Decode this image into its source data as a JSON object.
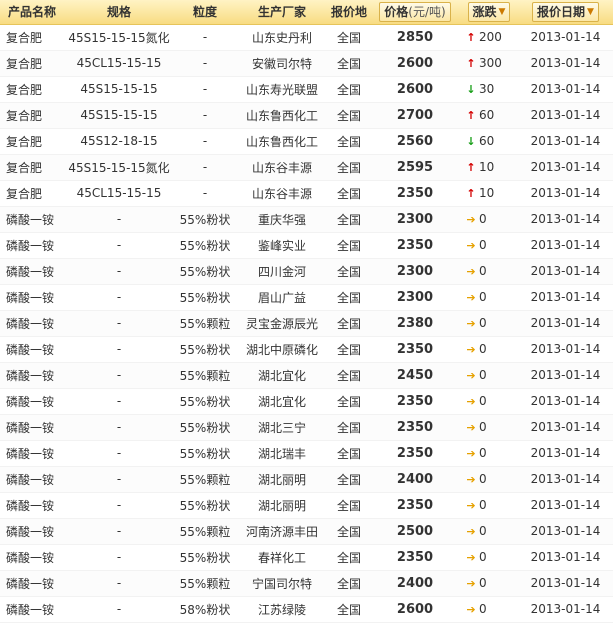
{
  "header": {
    "name": "产品名称",
    "spec": "规格",
    "granularity": "粒度",
    "manufacturer": "生产厂家",
    "region": "报价地",
    "price": "价格",
    "price_unit": "(元/吨)",
    "change": "涨跌",
    "date": "报价日期"
  },
  "icons": {
    "up": "arrow-up-icon",
    "down": "arrow-down-icon",
    "flat": "arrow-right-icon",
    "sort": "sort-down-icon"
  },
  "colors": {
    "up": "#d40000",
    "down": "#169e16",
    "flat": "#e6a100",
    "header_bg": "#f8dc82"
  },
  "rows": [
    {
      "name": "复合肥",
      "spec": "45S15-15-15氮化",
      "granularity": "-",
      "manufacturer": "山东史丹利",
      "region": "全国",
      "price": "2850",
      "trend": "up",
      "change": "200",
      "date": "2013-01-14"
    },
    {
      "name": "复合肥",
      "spec": "45CL15-15-15",
      "granularity": "-",
      "manufacturer": "安徽司尔特",
      "region": "全国",
      "price": "2600",
      "trend": "up",
      "change": "300",
      "date": "2013-01-14"
    },
    {
      "name": "复合肥",
      "spec": "45S15-15-15",
      "granularity": "-",
      "manufacturer": "山东寿光联盟",
      "region": "全国",
      "price": "2600",
      "trend": "down",
      "change": "30",
      "date": "2013-01-14"
    },
    {
      "name": "复合肥",
      "spec": "45S15-15-15",
      "granularity": "-",
      "manufacturer": "山东鲁西化工",
      "region": "全国",
      "price": "2700",
      "trend": "up",
      "change": "60",
      "date": "2013-01-14"
    },
    {
      "name": "复合肥",
      "spec": "45S12-18-15",
      "granularity": "-",
      "manufacturer": "山东鲁西化工",
      "region": "全国",
      "price": "2560",
      "trend": "down",
      "change": "60",
      "date": "2013-01-14"
    },
    {
      "name": "复合肥",
      "spec": "45S15-15-15氮化",
      "granularity": "-",
      "manufacturer": "山东谷丰源",
      "region": "全国",
      "price": "2595",
      "trend": "up",
      "change": "10",
      "date": "2013-01-14"
    },
    {
      "name": "复合肥",
      "spec": "45CL15-15-15",
      "granularity": "-",
      "manufacturer": "山东谷丰源",
      "region": "全国",
      "price": "2350",
      "trend": "up",
      "change": "10",
      "date": "2013-01-14"
    },
    {
      "name": "磷酸一铵",
      "spec": "-",
      "granularity": "55%粉状",
      "manufacturer": "重庆华强",
      "region": "全国",
      "price": "2300",
      "trend": "flat",
      "change": "0",
      "date": "2013-01-14"
    },
    {
      "name": "磷酸一铵",
      "spec": "-",
      "granularity": "55%粉状",
      "manufacturer": "鉴峰实业",
      "region": "全国",
      "price": "2350",
      "trend": "flat",
      "change": "0",
      "date": "2013-01-14"
    },
    {
      "name": "磷酸一铵",
      "spec": "-",
      "granularity": "55%粉状",
      "manufacturer": "四川金河",
      "region": "全国",
      "price": "2300",
      "trend": "flat",
      "change": "0",
      "date": "2013-01-14"
    },
    {
      "name": "磷酸一铵",
      "spec": "-",
      "granularity": "55%粉状",
      "manufacturer": "眉山广益",
      "region": "全国",
      "price": "2300",
      "trend": "flat",
      "change": "0",
      "date": "2013-01-14"
    },
    {
      "name": "磷酸一铵",
      "spec": "-",
      "granularity": "55%颗粒",
      "manufacturer": "灵宝金源辰光",
      "region": "全国",
      "price": "2380",
      "trend": "flat",
      "change": "0",
      "date": "2013-01-14"
    },
    {
      "name": "磷酸一铵",
      "spec": "-",
      "granularity": "55%粉状",
      "manufacturer": "湖北中原磷化",
      "region": "全国",
      "price": "2350",
      "trend": "flat",
      "change": "0",
      "date": "2013-01-14"
    },
    {
      "name": "磷酸一铵",
      "spec": "-",
      "granularity": "55%颗粒",
      "manufacturer": "湖北宜化",
      "region": "全国",
      "price": "2450",
      "trend": "flat",
      "change": "0",
      "date": "2013-01-14"
    },
    {
      "name": "磷酸一铵",
      "spec": "-",
      "granularity": "55%粉状",
      "manufacturer": "湖北宜化",
      "region": "全国",
      "price": "2350",
      "trend": "flat",
      "change": "0",
      "date": "2013-01-14"
    },
    {
      "name": "磷酸一铵",
      "spec": "-",
      "granularity": "55%粉状",
      "manufacturer": "湖北三宁",
      "region": "全国",
      "price": "2350",
      "trend": "flat",
      "change": "0",
      "date": "2013-01-14"
    },
    {
      "name": "磷酸一铵",
      "spec": "-",
      "granularity": "55%粉状",
      "manufacturer": "湖北瑞丰",
      "region": "全国",
      "price": "2350",
      "trend": "flat",
      "change": "0",
      "date": "2013-01-14"
    },
    {
      "name": "磷酸一铵",
      "spec": "-",
      "granularity": "55%颗粒",
      "manufacturer": "湖北丽明",
      "region": "全国",
      "price": "2400",
      "trend": "flat",
      "change": "0",
      "date": "2013-01-14"
    },
    {
      "name": "磷酸一铵",
      "spec": "-",
      "granularity": "55%粉状",
      "manufacturer": "湖北丽明",
      "region": "全国",
      "price": "2350",
      "trend": "flat",
      "change": "0",
      "date": "2013-01-14"
    },
    {
      "name": "磷酸一铵",
      "spec": "-",
      "granularity": "55%颗粒",
      "manufacturer": "河南济源丰田",
      "region": "全国",
      "price": "2500",
      "trend": "flat",
      "change": "0",
      "date": "2013-01-14"
    },
    {
      "name": "磷酸一铵",
      "spec": "-",
      "granularity": "55%粉状",
      "manufacturer": "春祥化工",
      "region": "全国",
      "price": "2350",
      "trend": "flat",
      "change": "0",
      "date": "2013-01-14"
    },
    {
      "name": "磷酸一铵",
      "spec": "-",
      "granularity": "55%颗粒",
      "manufacturer": "宁国司尔特",
      "region": "全国",
      "price": "2400",
      "trend": "flat",
      "change": "0",
      "date": "2013-01-14"
    },
    {
      "name": "磷酸一铵",
      "spec": "-",
      "granularity": "58%粉状",
      "manufacturer": "江苏绿陵",
      "region": "全国",
      "price": "2600",
      "trend": "flat",
      "change": "0",
      "date": "2013-01-14"
    }
  ]
}
